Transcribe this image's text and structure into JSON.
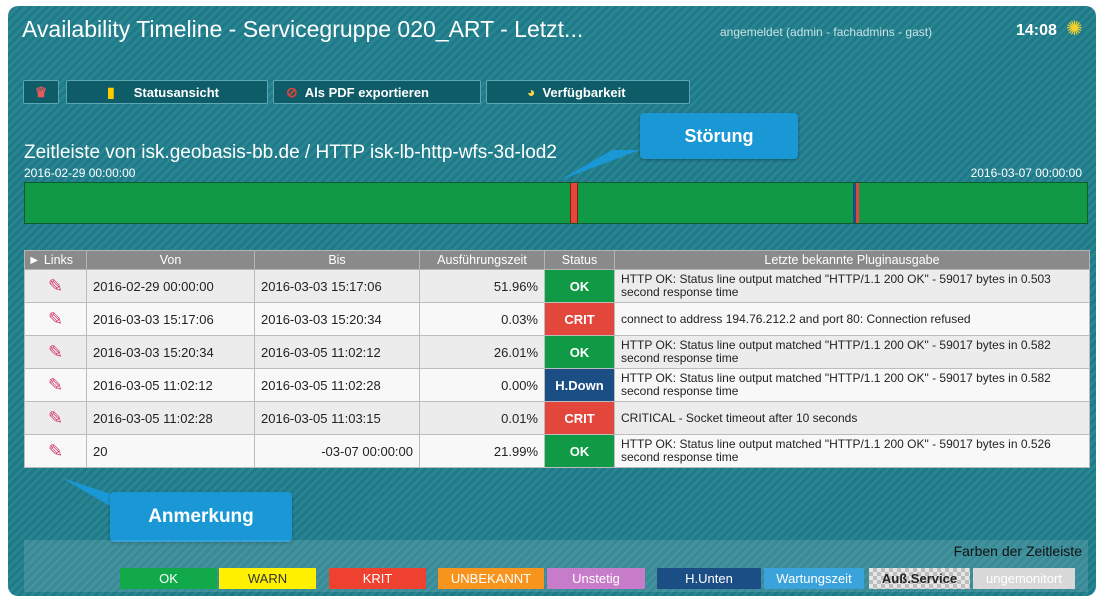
{
  "window": {
    "title": "Availability Timeline - Servicegruppe 020_ART - Letzt...",
    "user": "angemeldet (admin - fachadmins - gast)",
    "time": "14:08"
  },
  "toolbar": {
    "statusansicht": "Statusansicht",
    "pdf": "Als PDF exportieren",
    "verfuegbarkeit": "Verfügbarkeit"
  },
  "timeline": {
    "title": "Zeitleiste von isk.geobasis-bb.de / HTTP isk-lb-http-wfs-3d-lod2",
    "start": "2016-02-29 00:00:00",
    "end": "2016-03-07 00:00:00",
    "colors": {
      "ok": "#119a45",
      "crit": "#e3463a",
      "hdown": "#1c4e86"
    }
  },
  "callouts": {
    "stoerung": "Störung",
    "anmerkung": "Anmerkung"
  },
  "table": {
    "headers": [
      "► Links",
      "Von",
      "Bis",
      "Ausführungszeit",
      "Status",
      "Letzte bekannte Pluginausgabe"
    ],
    "rows": [
      {
        "von": "2016-02-29 00:00:00",
        "bis": "2016-03-03 15:17:06",
        "ausf": "51.96%",
        "status": "OK",
        "status_color": "#119a45",
        "output": "HTTP OK: Status line output matched \"HTTP/1.1 200 OK\" - 59017 bytes in 0.503 second response time"
      },
      {
        "von": "2016-03-03 15:17:06",
        "bis": "2016-03-03 15:20:34",
        "ausf": "0.03%",
        "status": "CRIT",
        "status_color": "#e3463a",
        "output": "connect to address 194.76.212.2 and port 80: Connection refused"
      },
      {
        "von": "2016-03-03 15:20:34",
        "bis": "2016-03-05 11:02:12",
        "ausf": "26.01%",
        "status": "OK",
        "status_color": "#119a45",
        "output": "HTTP OK: Status line output matched \"HTTP/1.1 200 OK\" - 59017 bytes in 0.582 second response time"
      },
      {
        "von": "2016-03-05 11:02:12",
        "bis": "2016-03-05 11:02:28",
        "ausf": "0.00%",
        "status": "H.Down",
        "status_color": "#1c4e86",
        "output": "HTTP OK: Status line output matched \"HTTP/1.1 200 OK\" - 59017 bytes in 0.582 second response time"
      },
      {
        "von": "2016-03-05 11:02:28",
        "bis": "2016-03-05 11:03:15",
        "ausf": "0.01%",
        "status": "CRIT",
        "status_color": "#e3463a",
        "output": "CRITICAL - Socket timeout after 10 seconds"
      },
      {
        "von": "20",
        "bis": "-03-07 00:00:00",
        "ausf": "21.99%",
        "status": "OK",
        "status_color": "#119a45",
        "output": "HTTP OK: Status line output matched \"HTTP/1.1 200 OK\" - 59017 bytes in 0.526 second response time"
      }
    ]
  },
  "legend": {
    "title": "Farben der Zeitleiste",
    "items": [
      {
        "label": "OK",
        "bg": "#11a94a",
        "fg": "#ffffff"
      },
      {
        "label": "WARN",
        "bg": "#fff100",
        "fg": "#333333"
      },
      {
        "label": "KRIT",
        "bg": "#ee4130",
        "fg": "#ffffff"
      },
      {
        "label": "UNBEKANNT",
        "bg": "#f6941e",
        "fg": "#ffffff"
      },
      {
        "label": "Unstetig",
        "bg": "#c77cc9",
        "fg": "#ffffff"
      },
      {
        "label": "H.Unten",
        "bg": "#1c4e86",
        "fg": "#ffffff"
      },
      {
        "label": "Wartungszeit",
        "bg": "#3aa3dc",
        "fg": "#ffffff"
      },
      {
        "label": "Auß.Service",
        "bg": "#c8c8c8",
        "fg": "#222222"
      },
      {
        "label": "ungemonitort",
        "bg": "#d8d8d8",
        "fg": "#ffffff"
      }
    ]
  }
}
